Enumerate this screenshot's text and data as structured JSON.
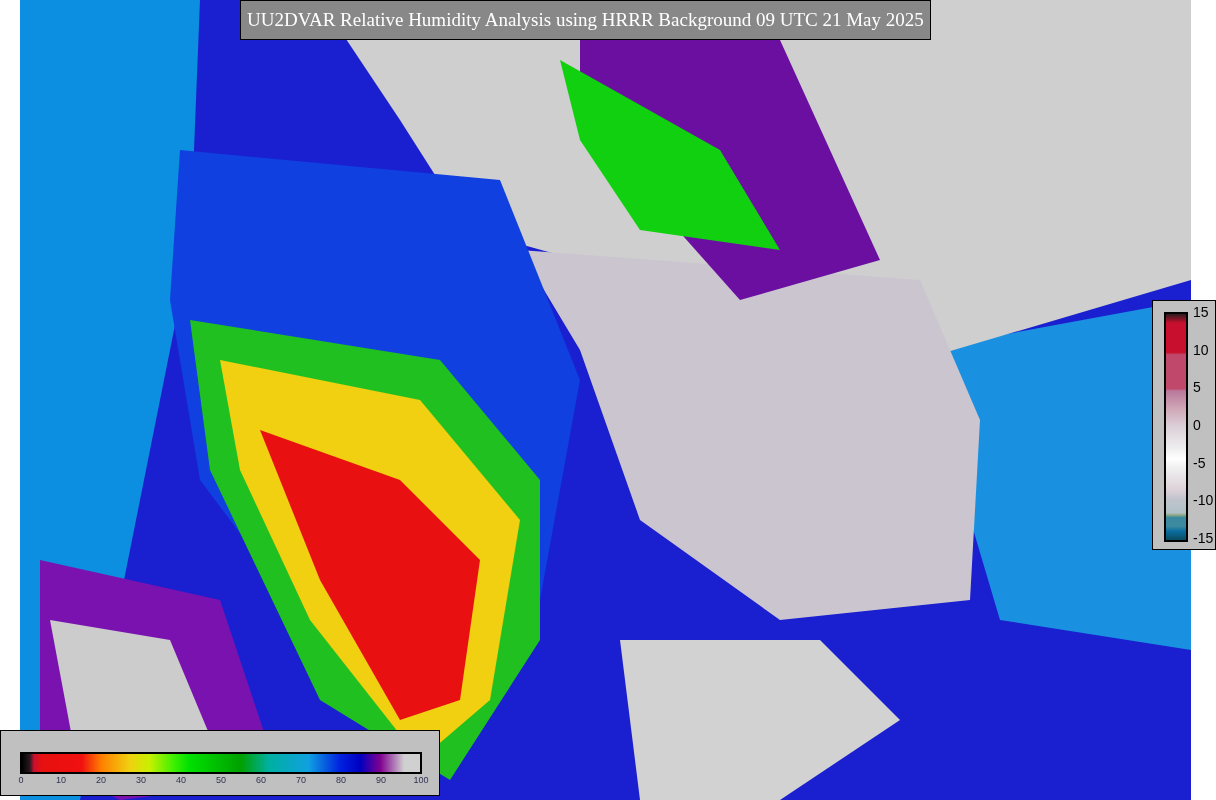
{
  "title": "UU2DVAR Relative Humidity Analysis using HRRR Background 09 UTC 21 May 2025",
  "difference_colorbar": {
    "labels": [
      "15",
      "10",
      "5",
      "0",
      "-5",
      "-10",
      "-15"
    ]
  },
  "humidity_colorbar": {
    "labels": [
      "0",
      "10",
      "20",
      "30",
      "40",
      "50",
      "60",
      "70",
      "80",
      "90",
      "100"
    ]
  }
}
